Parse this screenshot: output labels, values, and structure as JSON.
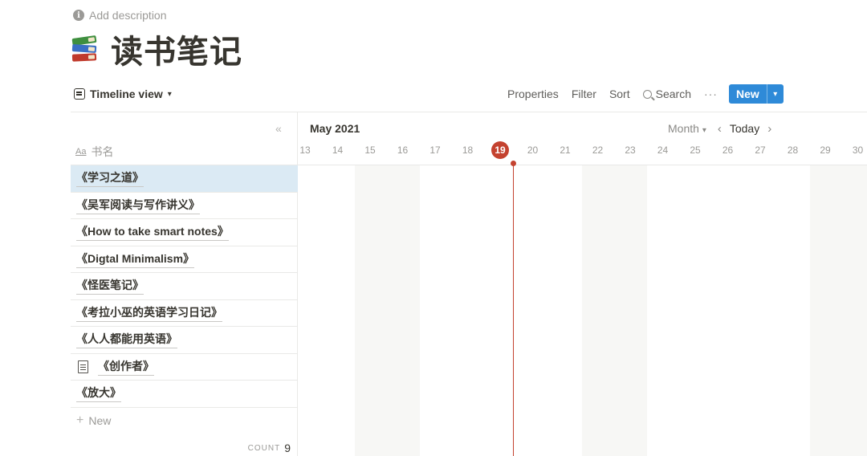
{
  "header": {
    "add_description": "Add description",
    "title": "读书笔记",
    "title_icon": "books-emoji-icon"
  },
  "toolbar": {
    "view_label": "Timeline view",
    "properties": "Properties",
    "filter": "Filter",
    "sort": "Sort",
    "search": "Search",
    "more": "···",
    "new_label": "New",
    "accent_color": "#2e8ad8"
  },
  "table": {
    "column_icon": "Aa",
    "column_title": "书名",
    "rows": [
      {
        "title": "《学习之道》",
        "selected": true
      },
      {
        "title": "《吴军阅读与写作讲义》"
      },
      {
        "title": "《How to take smart notes》"
      },
      {
        "title": "《Digtal Minimalism》"
      },
      {
        "title": "《怪医笔记》"
      },
      {
        "title": "《考拉小巫的英语学习日记》"
      },
      {
        "title": "《人人都能用英语》"
      },
      {
        "title": "《创作者》",
        "icon": "document-icon"
      },
      {
        "title": "《放大》"
      }
    ],
    "new_row": "New",
    "count_label": "COUNT",
    "count_value": "9"
  },
  "timeline": {
    "month": "May 2021",
    "scale": "Month",
    "today_label": "Today",
    "today_color": "#c4422f",
    "days": [
      "13",
      "14",
      "15",
      "16",
      "17",
      "18",
      "19",
      "20",
      "21",
      "22",
      "23",
      "24",
      "25",
      "26",
      "27",
      "28",
      "29",
      "30"
    ],
    "today_day": "19"
  }
}
